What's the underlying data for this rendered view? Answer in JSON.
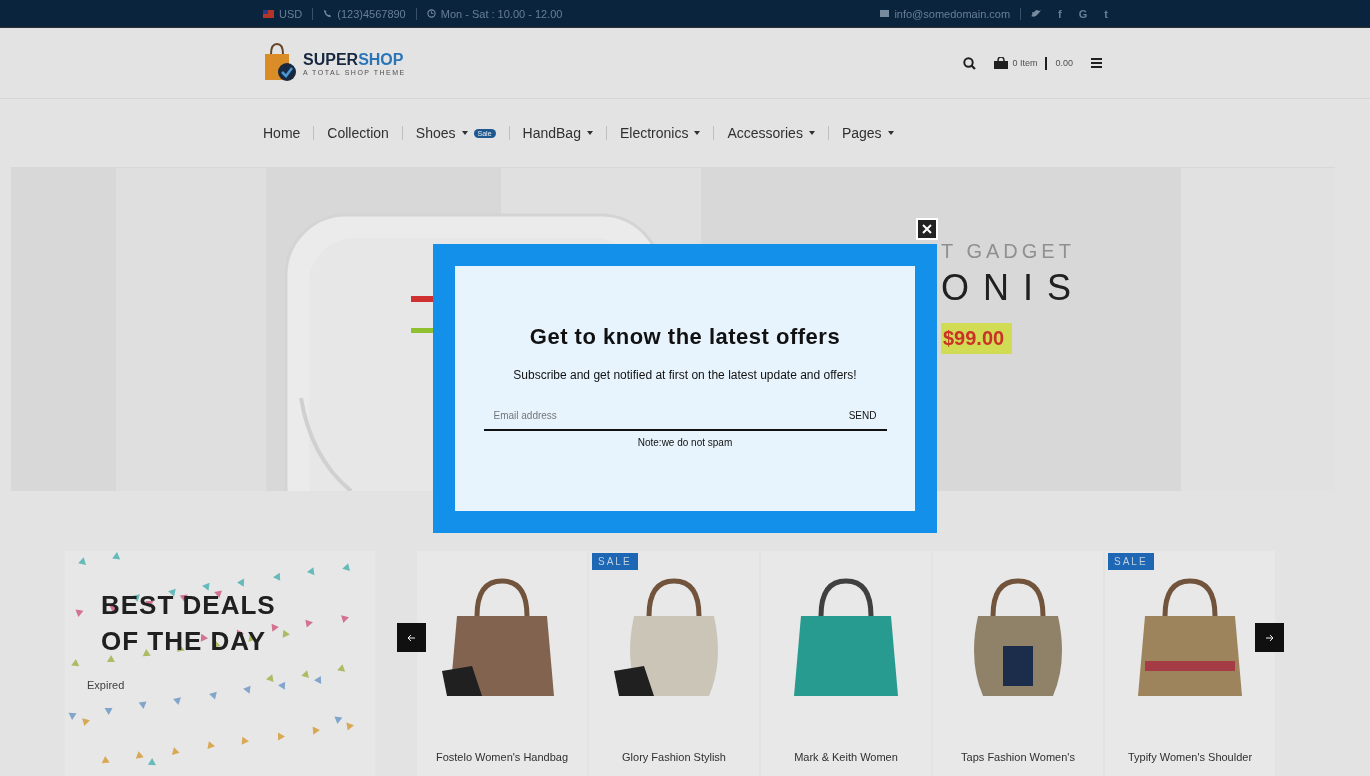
{
  "topbar": {
    "currency": "USD",
    "phone": "(123)4567890",
    "hours": "Mon - Sat : 10.00 - 12.00",
    "email": "info@somedomain.com",
    "social": [
      "f",
      "G",
      "t"
    ]
  },
  "header": {
    "logo_1": "SUPER",
    "logo_2": "SHOP",
    "tagline": "A TOTAL SHOP THEME",
    "cart_count": "0 Item",
    "cart_total": "0.00"
  },
  "nav": [
    {
      "label": "Home",
      "dropdown": false
    },
    {
      "label": "Collection",
      "dropdown": false
    },
    {
      "label": "Shoes",
      "dropdown": true,
      "badge": "Sale"
    },
    {
      "label": "HandBag",
      "dropdown": true
    },
    {
      "label": "Electronics",
      "dropdown": true
    },
    {
      "label": "Accessories",
      "dropdown": true
    },
    {
      "label": "Pages",
      "dropdown": true
    }
  ],
  "hero": {
    "kind": "picture",
    "subtitle": "T GADGET",
    "title": "ONIS",
    "price": "$99.00"
  },
  "deals": {
    "title_1": "BEST DEALS",
    "title_2": "OF THE DAY",
    "status": "Expired"
  },
  "products": [
    {
      "name": "Fostelo Women's Handbag",
      "sale": false
    },
    {
      "name": "Glory Fashion Stylish",
      "sale": true,
      "badge": "SALE"
    },
    {
      "name": "Mark & Keith Women",
      "sale": false
    },
    {
      "name": "Taps Fashion Women's",
      "sale": false
    },
    {
      "name": "Typify Women's Shoulder",
      "sale": true,
      "badge": "SALE"
    }
  ],
  "popup": {
    "title": "Get to know the latest offers",
    "text": "Subscribe and get notified at first on the latest update and offers!",
    "placeholder": "Email address",
    "button": "SEND",
    "note": "Note:we do not spam"
  }
}
